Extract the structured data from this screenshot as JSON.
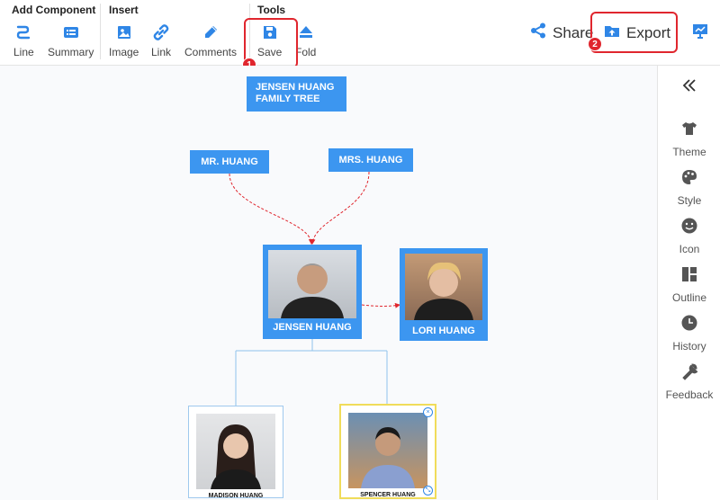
{
  "toolbar": {
    "groups": {
      "add_component": "Add Component",
      "insert": "Insert",
      "tools": "Tools"
    },
    "tools": {
      "line": "Line",
      "summary": "Summary",
      "image": "Image",
      "link": "Link",
      "comments": "Comments",
      "save": "Save",
      "fold": "Fold"
    },
    "share_label": "Share",
    "export_label": "Export",
    "step_badges": [
      "1",
      "2"
    ],
    "icons": [
      "line-icon",
      "summary-icon",
      "image-icon",
      "link-icon",
      "comments-icon",
      "save-icon",
      "fold-icon",
      "share-icon",
      "export-icon",
      "present-icon"
    ]
  },
  "sidebar": {
    "items": [
      {
        "label": "Theme",
        "icon": "shirt-icon"
      },
      {
        "label": "Style",
        "icon": "palette-icon"
      },
      {
        "label": "Icon",
        "icon": "smiley-icon"
      },
      {
        "label": "Outline",
        "icon": "outline-icon"
      },
      {
        "label": "History",
        "icon": "clock-icon"
      },
      {
        "label": "Feedback",
        "icon": "wrench-icon"
      }
    ]
  },
  "diagram": {
    "title": "JENSEN HUANG FAMILY TREE",
    "father": "MR. HUANG",
    "mother": "MRS. HUANG",
    "main": "JENSEN HUANG",
    "spouse": "LORI HUANG",
    "children": [
      "MADISON HUANG",
      "SPENCER HUANG"
    ]
  },
  "colors": {
    "accent": "#3c96f0",
    "highlight": "#e0262e",
    "relationship_line": "#e0262e",
    "child_line": "#8fc3ec"
  }
}
